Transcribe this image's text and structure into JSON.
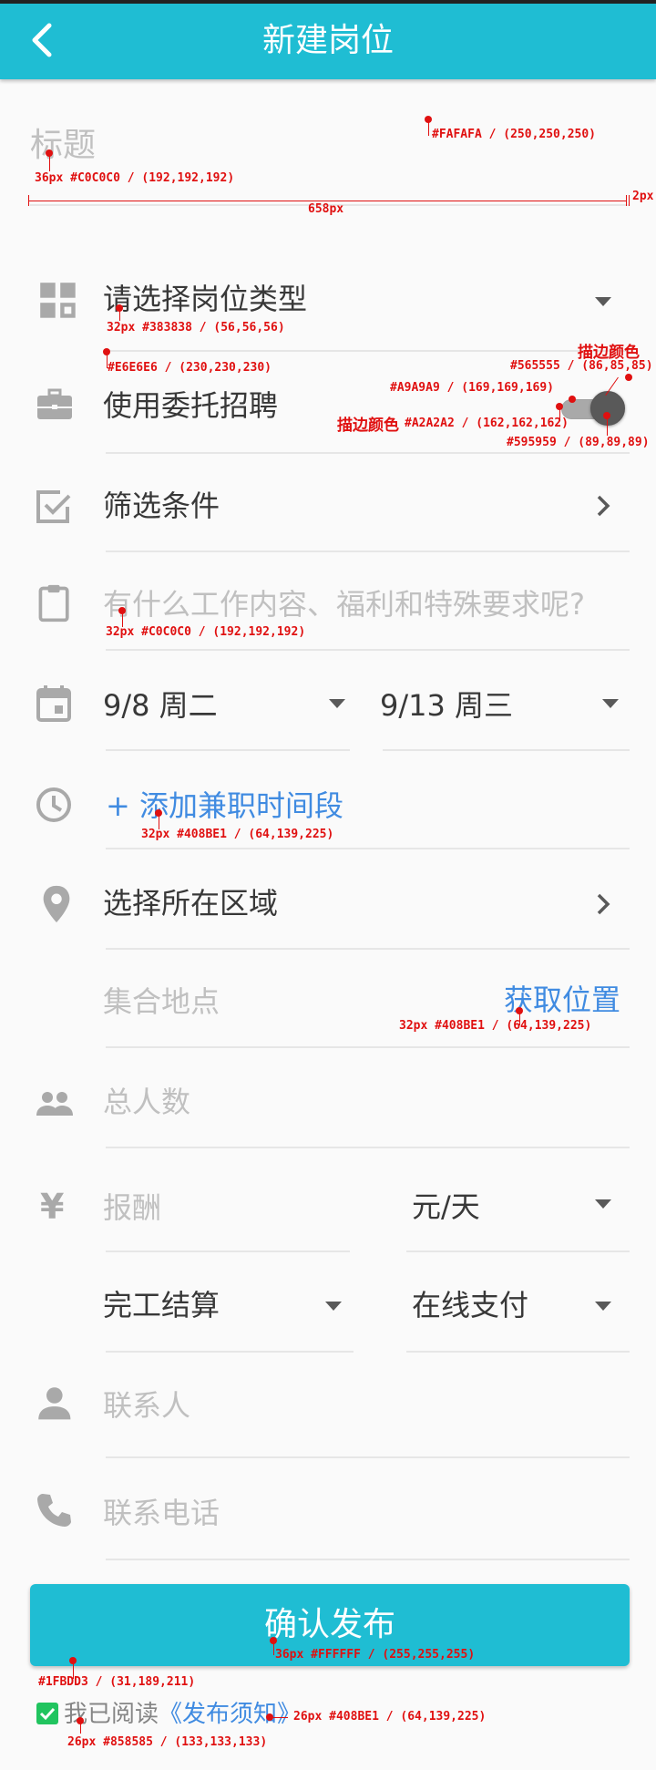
{
  "appbar": {
    "title": "新建岗位"
  },
  "form": {
    "title_placeholder": "标题",
    "job_type_placeholder": "请选择岗位类型",
    "entrust_label": "使用委托招聘",
    "filter_label": "筛选条件",
    "content_placeholder": "有什么工作内容、福利和特殊要求呢?",
    "start_date": "9/8  周二",
    "end_date": "9/13  周三",
    "add_time_label": "+ 添加兼职时间段",
    "region_label": "选择所在区域",
    "meeting_point_placeholder": "集合地点",
    "get_location_label": "获取位置",
    "total_people_placeholder": "总人数",
    "currency_symbol": "¥",
    "pay_placeholder": "报酬",
    "pay_unit": "元/天",
    "settlement": "完工结算",
    "payment_method": "在线支付",
    "contact_placeholder": "联系人",
    "phone_placeholder": "联系电话"
  },
  "submit": {
    "label": "确认发布"
  },
  "agreement": {
    "prefix": "我已阅读",
    "link": "《发布须知》",
    "checked": true
  },
  "annotations": {
    "bg_color": "#FAFAFA / (250,250,250)",
    "title_spec": "36px #C0C0C0 / (192,192,192)",
    "width_spec": "658px",
    "edge_spec": "2px",
    "jobtype_spec": "32px #383838 / (56,56,56)",
    "divider_spec": "#E6E6E6 / (230,230,230)",
    "stroke_label_1": "描边颜色",
    "stroke_color_1": "#565555 / (86,85,85)",
    "track_color": "#A9A9A9 / (169,169,169)",
    "stroke_label_2": "描边颜色",
    "stroke_color_2": "#A2A2A2 / (162,162,162)",
    "thumb_color": "#595959 / (89,89,89)",
    "content_spec": "32px #C0C0C0 / (192,192,192)",
    "add_time_spec": "32px #408BE1 / (64,139,225)",
    "location_spec": "32px #408BE1 / (64,139,225)",
    "button_color": "#1FBDD3 / (31,189,211)",
    "button_text_spec": "36px #FFFFFF / (255,255,255)",
    "link_spec": "26px #408BE1 / (64,139,225)",
    "agree_spec": "26px #858585 / (133,133,133)"
  },
  "colors": {
    "primary": "#1FBDD3",
    "link": "#408BE1",
    "text": "#383838",
    "placeholder": "#C0C0C0",
    "divider": "#E6E6E6",
    "background": "#FAFAFA"
  }
}
